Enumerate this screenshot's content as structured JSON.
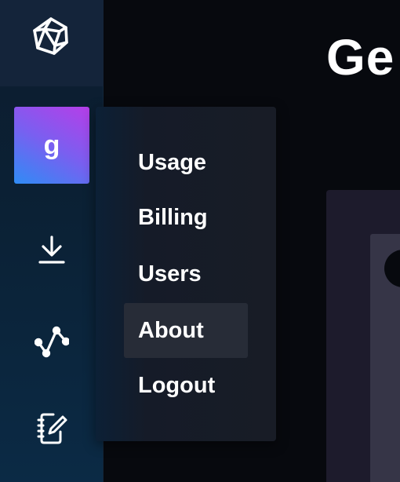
{
  "sidebar": {
    "logo_icon": "polyhedron-logo-icon",
    "avatar_initial": "g",
    "avatar_gradient": [
      "#2f8cf5",
      "#b63ee8"
    ],
    "icons": [
      "download-icon",
      "graph-icon",
      "notebook-edit-icon"
    ]
  },
  "header": {
    "title": "Ge"
  },
  "user_menu": {
    "items": [
      {
        "label": "Usage"
      },
      {
        "label": "Billing"
      },
      {
        "label": "Users"
      },
      {
        "label": "About"
      },
      {
        "label": "Logout"
      }
    ],
    "active_item": "About"
  },
  "colors": {
    "background": "#07090e",
    "sidebar": "#0b2135",
    "menu": "#181c26",
    "menu_highlight": "#272c37",
    "text": "#ffffff"
  }
}
